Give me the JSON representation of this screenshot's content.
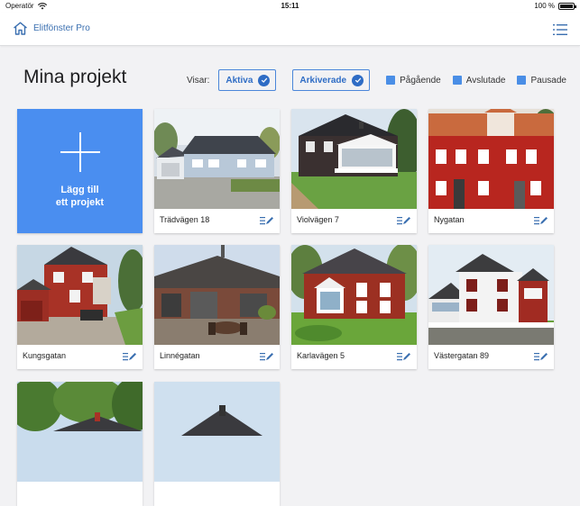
{
  "status_bar": {
    "carrier": "Operatör",
    "time": "15:11",
    "battery": "100 %"
  },
  "app_bar": {
    "brand": "Elitfönster Pro",
    "home_icon": "home-icon",
    "menu_icon": "list-menu-icon"
  },
  "page": {
    "title": "Mina projekt"
  },
  "filters": {
    "label": "Visar:",
    "toggles": [
      {
        "label": "Aktiva",
        "selected": true
      },
      {
        "label": "Arkiverade",
        "selected": true
      }
    ],
    "checkboxes": [
      {
        "label": "Pågående"
      },
      {
        "label": "Avslutade"
      },
      {
        "label": "Pausade"
      }
    ]
  },
  "add_card": {
    "label": "Lägg till\nett projekt"
  },
  "projects": [
    {
      "name": "Trädvägen 18"
    },
    {
      "name": "Violvägen 7"
    },
    {
      "name": "Nygatan"
    },
    {
      "name": "Kungsgatan"
    },
    {
      "name": "Linnégatan"
    },
    {
      "name": "Karlavägen 5"
    },
    {
      "name": "Västergatan 89"
    },
    {
      "name": ""
    },
    {
      "name": ""
    }
  ],
  "colors": {
    "accent": "#4a8ef0",
    "brand_blue": "#3a6fb0",
    "background": "#f2f2f4"
  }
}
